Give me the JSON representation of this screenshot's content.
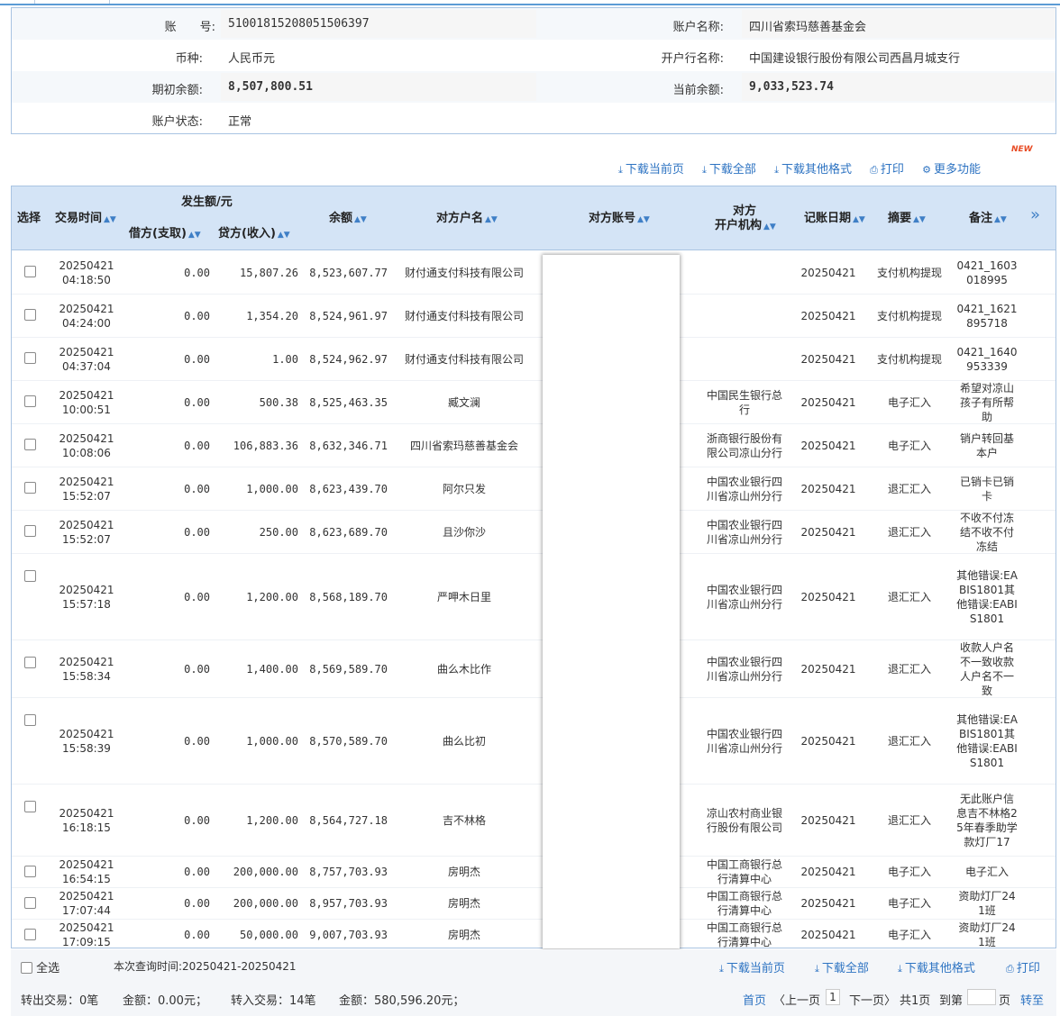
{
  "account": {
    "account_no_label": "账　　号:",
    "account_no": "51001815208051506397",
    "account_name_label": "账户名称:",
    "account_name": "四川省索玛慈善基金会",
    "currency_label": "币种:",
    "currency": "人民币元",
    "bank_label": "开户行名称:",
    "bank": "中国建设银行股份有限公司西昌月城支行",
    "opening_balance_label": "期初余额:",
    "opening_balance": "8,507,800.51",
    "current_balance_label": "当前余额:",
    "current_balance": "9,033,523.74",
    "status_label": "账户状态:",
    "status": "正常"
  },
  "toolbar": {
    "download_current": "下载当前页",
    "download_all": "下载全部",
    "download_other": "下载其他格式",
    "print": "打印",
    "more": "更多功能",
    "new_badge": "NEW"
  },
  "table": {
    "headers": {
      "select": "选择",
      "time": "交易时间",
      "amount_group": "发生额/元",
      "debit": "借方(支取)",
      "credit": "贷方(收入)",
      "balance": "余额",
      "counterparty_name": "对方户名",
      "counterparty_account": "对方账号",
      "counterparty_bank_1": "对方",
      "counterparty_bank_2": "开户机构",
      "post_date": "记账日期",
      "summary": "摘要",
      "remark": "备注",
      "expand": "»"
    },
    "rows": [
      {
        "date": "20250421",
        "time": "04:18:50",
        "debit": "0.00",
        "credit": "15,807.26",
        "balance": "8,523,607.77",
        "name": "财付通支付科技有限公司",
        "bank": "",
        "post": "20250421",
        "summary": "支付机构提现",
        "remark": "0421_1603018995"
      },
      {
        "date": "20250421",
        "time": "04:24:00",
        "debit": "0.00",
        "credit": "1,354.20",
        "balance": "8,524,961.97",
        "name": "财付通支付科技有限公司",
        "bank": "",
        "post": "20250421",
        "summary": "支付机构提现",
        "remark": "0421_1621895718"
      },
      {
        "date": "20250421",
        "time": "04:37:04",
        "debit": "0.00",
        "credit": "1.00",
        "balance": "8,524,962.97",
        "name": "财付通支付科技有限公司",
        "bank": "",
        "post": "20250421",
        "summary": "支付机构提现",
        "remark": "0421_1640953339"
      },
      {
        "date": "20250421",
        "time": "10:00:51",
        "debit": "0.00",
        "credit": "500.38",
        "balance": "8,525,463.35",
        "name": "臧文澜",
        "bank": "中国民生银行总行",
        "post": "20250421",
        "summary": "电子汇入",
        "remark": "希望对凉山孩子有所帮助"
      },
      {
        "date": "20250421",
        "time": "10:08:06",
        "debit": "0.00",
        "credit": "106,883.36",
        "balance": "8,632,346.71",
        "name": "四川省索玛慈善基金会",
        "bank": "浙商银行股份有限公司凉山分行",
        "post": "20250421",
        "summary": "电子汇入",
        "remark": "销户转回基本户"
      },
      {
        "date": "20250421",
        "time": "15:52:07",
        "debit": "0.00",
        "credit": "1,000.00",
        "balance": "8,623,439.70",
        "name": "阿尔只发",
        "bank": "中国农业银行四川省凉山州分行",
        "post": "20250421",
        "summary": "退汇汇入",
        "remark": "已销卡已销卡"
      },
      {
        "date": "20250421",
        "time": "15:52:07",
        "debit": "0.00",
        "credit": "250.00",
        "balance": "8,623,689.70",
        "name": "且沙你沙",
        "bank": "中国农业银行四川省凉山州分行",
        "post": "20250421",
        "summary": "退汇汇入",
        "remark": "不收不付冻结不收不付冻结"
      },
      {
        "date": "20250421",
        "time": "15:57:18",
        "debit": "0.00",
        "credit": "1,200.00",
        "balance": "8,568,189.70",
        "name": "严呷木日里",
        "bank": "中国农业银行四川省凉山州分行",
        "post": "20250421",
        "summary": "退汇汇入",
        "remark": "其他错误:EABIS1801其他错误:EABIS1801"
      },
      {
        "date": "20250421",
        "time": "15:58:34",
        "debit": "0.00",
        "credit": "1,400.00",
        "balance": "8,569,589.70",
        "name": "曲么木比作",
        "bank": "中国农业银行四川省凉山州分行",
        "post": "20250421",
        "summary": "退汇汇入",
        "remark": "收款人户名不一致收款人户名不一致"
      },
      {
        "date": "20250421",
        "time": "15:58:39",
        "debit": "0.00",
        "credit": "1,000.00",
        "balance": "8,570,589.70",
        "name": "曲么比初",
        "bank": "中国农业银行四川省凉山州分行",
        "post": "20250421",
        "summary": "退汇汇入",
        "remark": "其他错误:EABIS1801其他错误:EABIS1801"
      },
      {
        "date": "20250421",
        "time": "16:18:15",
        "debit": "0.00",
        "credit": "1,200.00",
        "balance": "8,564,727.18",
        "name": "吉不林格",
        "bank": "凉山农村商业银行股份有限公司",
        "post": "20250421",
        "summary": "退汇汇入",
        "remark": "无此账户信息吉不林格25年春季助学款灯厂17"
      },
      {
        "date": "20250421",
        "time": "16:54:15",
        "debit": "0.00",
        "credit": "200,000.00",
        "balance": "8,757,703.93",
        "name": "房明杰",
        "bank": "中国工商银行总行清算中心",
        "post": "20250421",
        "summary": "电子汇入",
        "remark": "电子汇入"
      },
      {
        "date": "20250421",
        "time": "17:07:44",
        "debit": "0.00",
        "credit": "200,000.00",
        "balance": "8,957,703.93",
        "name": "房明杰",
        "bank": "中国工商银行总行清算中心",
        "post": "20250421",
        "summary": "电子汇入",
        "remark": "资助灯厂241班"
      },
      {
        "date": "20250421",
        "time": "17:09:15",
        "debit": "0.00",
        "credit": "50,000.00",
        "balance": "9,007,703.93",
        "name": "房明杰",
        "bank": "中国工商银行总行清算中心",
        "post": "20250421",
        "summary": "电子汇入",
        "remark": "资助灯厂241班"
      }
    ]
  },
  "footer": {
    "select_all": "全选",
    "query_time": "本次查询时间:20250421-20250421",
    "out_count": "转出交易：0笔",
    "out_amount": "金额：0.00元；",
    "in_count": "转入交易：14笔",
    "in_amount": "金额：580,596.20元；",
    "download_current": "下载当前页",
    "download_all": "下载全部",
    "download_other": "下载其他格式",
    "print": "打印",
    "first": "首页",
    "prev": "〈上一页",
    "page": "1",
    "next": "下一页〉",
    "total": "共1页",
    "goto": "到第",
    "page_unit": "页",
    "go": "转至"
  }
}
